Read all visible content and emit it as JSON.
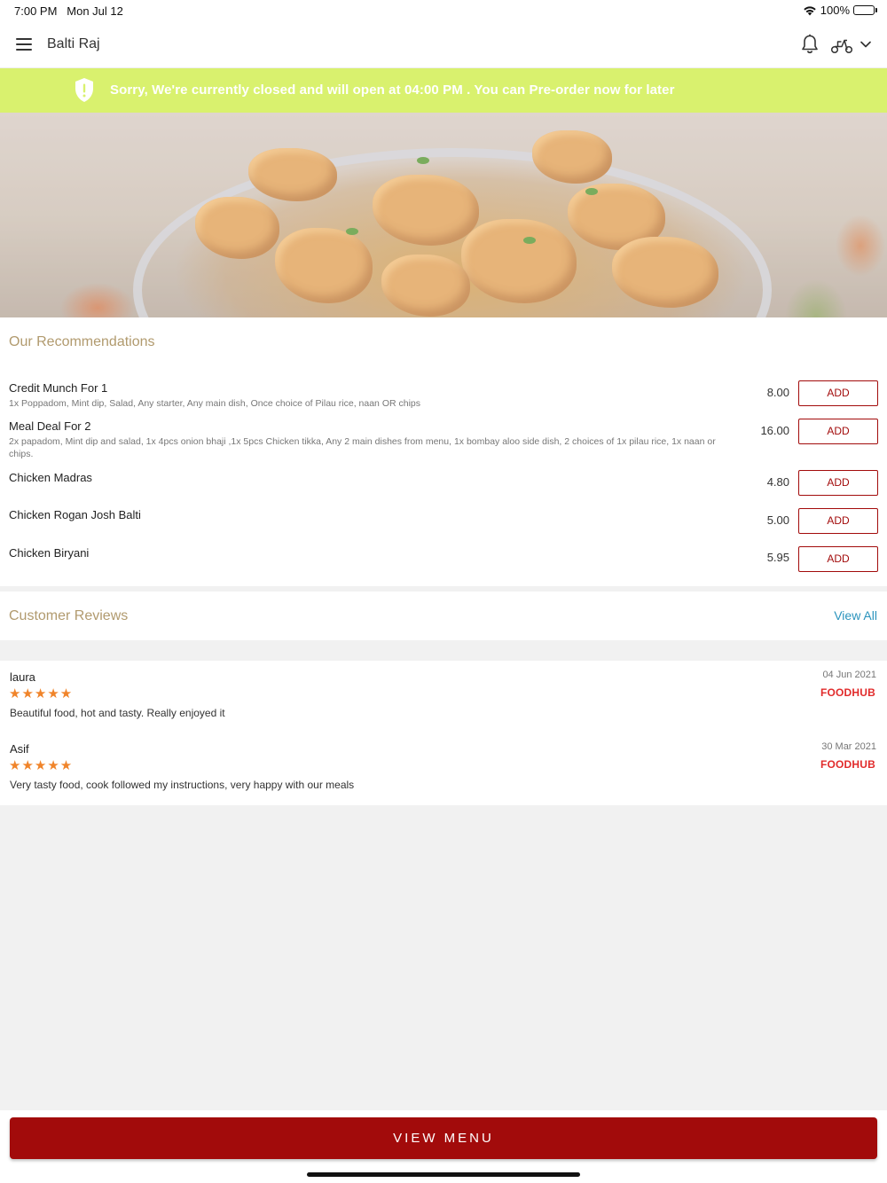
{
  "status_bar": {
    "time": "7:00 PM",
    "date": "Mon Jul 12",
    "battery": "100%"
  },
  "header": {
    "title": "Balti Raj",
    "icons": [
      "menu-icon",
      "bell-icon",
      "scooter-icon",
      "chevron-down-icon"
    ]
  },
  "banner": {
    "message": "Sorry, We're currently closed and will open at 04:00 PM . You can Pre-order now for later",
    "icon": "shield-alert-icon",
    "color": "#d9f16e"
  },
  "recommendations": {
    "title": "Our Recommendations",
    "items": [
      {
        "name": "Credit Munch For 1",
        "description": "1x Poppadom, Mint dip, Salad, Any starter, Any main dish, Once choice of Pilau rice, naan OR chips",
        "price": "8.00",
        "button": "ADD"
      },
      {
        "name": "Meal Deal For 2",
        "description": "2x papadom, Mint dip and salad, 1x 4pcs onion bhaji ,1x 5pcs Chicken tikka, Any 2 main dishes from menu, 1x bombay aloo side dish, 2 choices of 1x pilau rice, 1x naan or chips.",
        "price": "16.00",
        "button": "ADD"
      },
      {
        "name": "Chicken Madras",
        "description": "",
        "price": "4.80",
        "button": "ADD"
      },
      {
        "name": "Chicken Rogan Josh Balti",
        "description": "",
        "price": "5.00",
        "button": "ADD"
      },
      {
        "name": "Chicken Biryani",
        "description": "",
        "price": "5.95",
        "button": "ADD"
      }
    ]
  },
  "reviews": {
    "title": "Customer Reviews",
    "view_all": "View All",
    "items": [
      {
        "author": "laura",
        "rating": 5,
        "stars": "★★★★★",
        "text": "Beautiful food, hot and tasty. Really enjoyed it",
        "date": "04 Jun 2021",
        "source": "FOODHUB"
      },
      {
        "author": "Asif",
        "rating": 5,
        "stars": "★★★★★",
        "text": "Very tasty food, cook followed my instructions, very happy with our meals",
        "date": "30 Mar 2021",
        "source": "FOODHUB"
      }
    ]
  },
  "footer": {
    "button": "VIEW MENU"
  },
  "colors": {
    "accent": "#a20b0b",
    "section_title": "#b19a6e",
    "link": "#2b94bd",
    "stars": "#f0842a",
    "brand": "#e12b2b"
  }
}
